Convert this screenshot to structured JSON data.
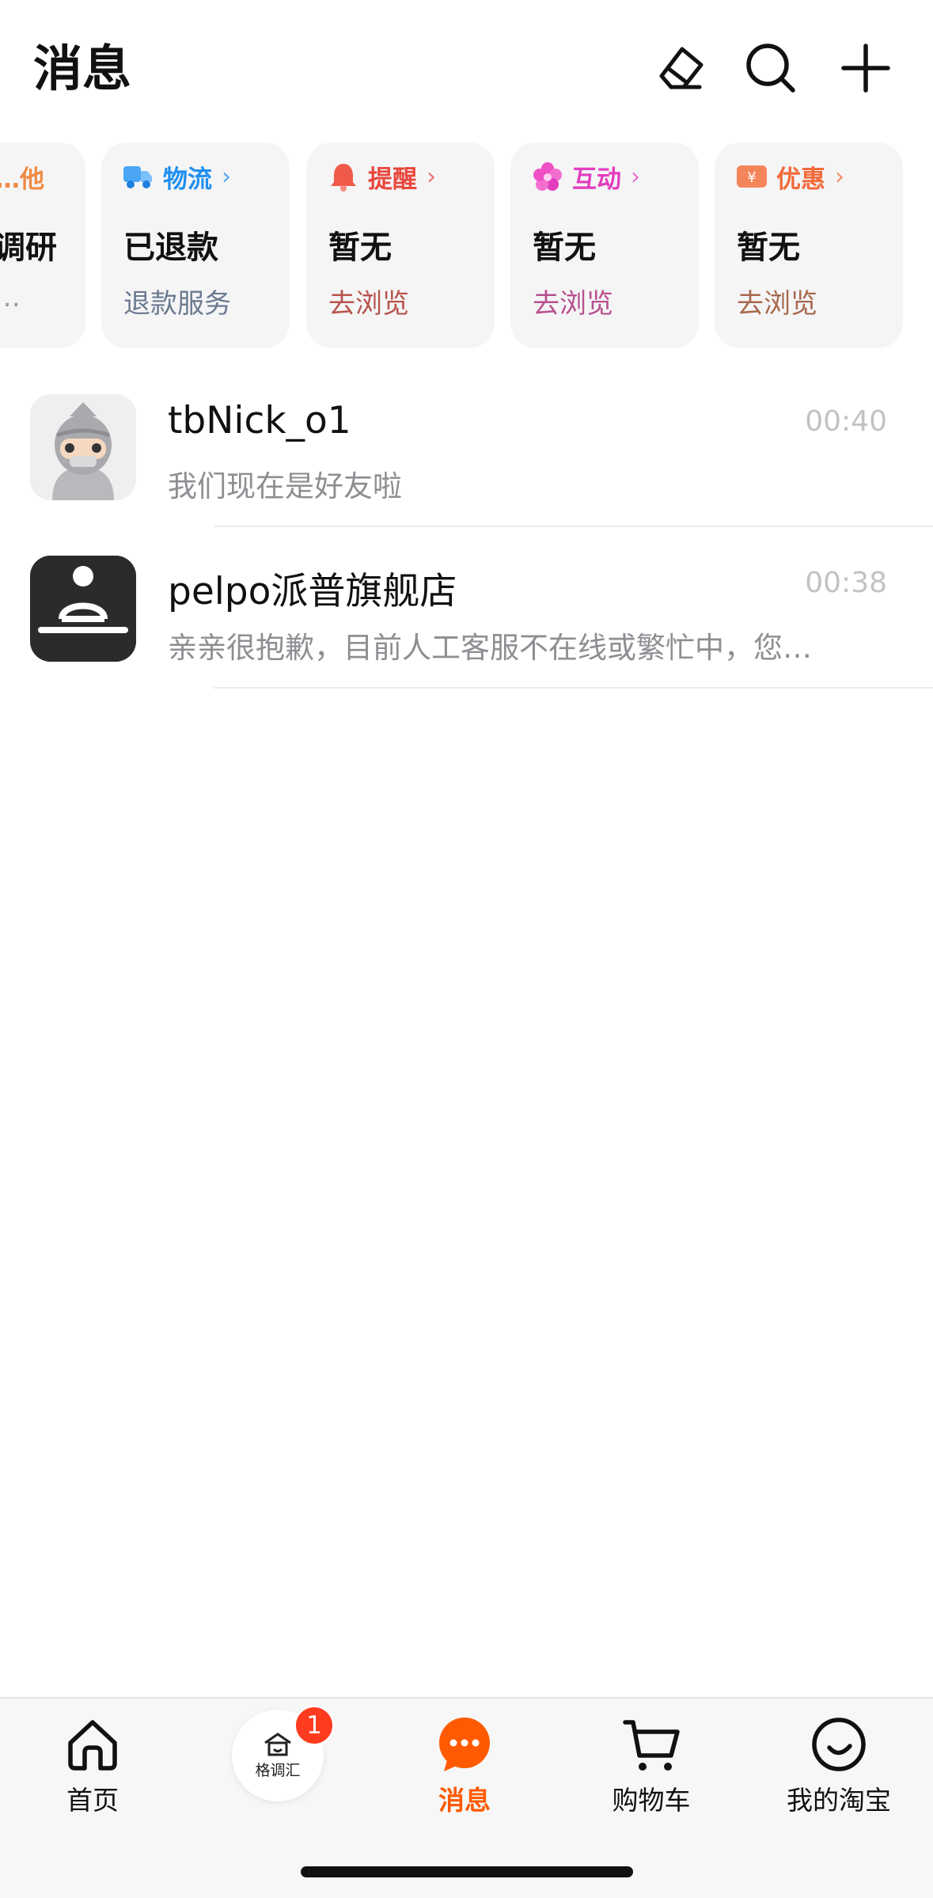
{
  "header": {
    "title": "消息",
    "actions": {
      "clear": "eraser-icon",
      "search": "search-icon",
      "add": "plus-icon"
    }
  },
  "categories": [
    {
      "label": "…他",
      "status": "调研",
      "sub": "…",
      "color": "#f08a43",
      "icon": "chevron-icon"
    },
    {
      "label": "物流",
      "status": "已退款",
      "sub": "退款服务",
      "color": "#1f8ff0",
      "subcolor": "#6b7a90",
      "icon": "truck-icon"
    },
    {
      "label": "提醒",
      "status": "暂无",
      "sub": "去浏览",
      "color": "#e8473c",
      "subcolor": "#b8544c",
      "icon": "bell-icon"
    },
    {
      "label": "互动",
      "status": "暂无",
      "sub": "去浏览",
      "color": "#e23dbf",
      "subcolor": "#b8508e",
      "icon": "flower-icon"
    },
    {
      "label": "优惠",
      "status": "暂无",
      "sub": "去浏览",
      "color": "#f26b3a",
      "subcolor": "#a8684c",
      "icon": "coupon-icon"
    }
  ],
  "conversations": [
    {
      "name": "tbNick_o1",
      "time": "00:40",
      "preview": "我们现在是好友啦",
      "avatar": "ninja-avatar"
    },
    {
      "name": "pelpo派普旗舰店",
      "time": "00:38",
      "preview": "亲亲很抱歉，目前人工客服不在线或繁忙中，您…",
      "avatar": "pelpo-logo"
    }
  ],
  "tabbar": {
    "items": [
      {
        "label": "首页",
        "icon": "home-icon"
      },
      {
        "label": "格调汇",
        "icon": "house-icon",
        "badge": "1"
      },
      {
        "label": "消息",
        "icon": "message-icon",
        "active": true
      },
      {
        "label": "购物车",
        "icon": "cart-icon"
      },
      {
        "label": "我的淘宝",
        "icon": "smile-icon"
      }
    ]
  }
}
